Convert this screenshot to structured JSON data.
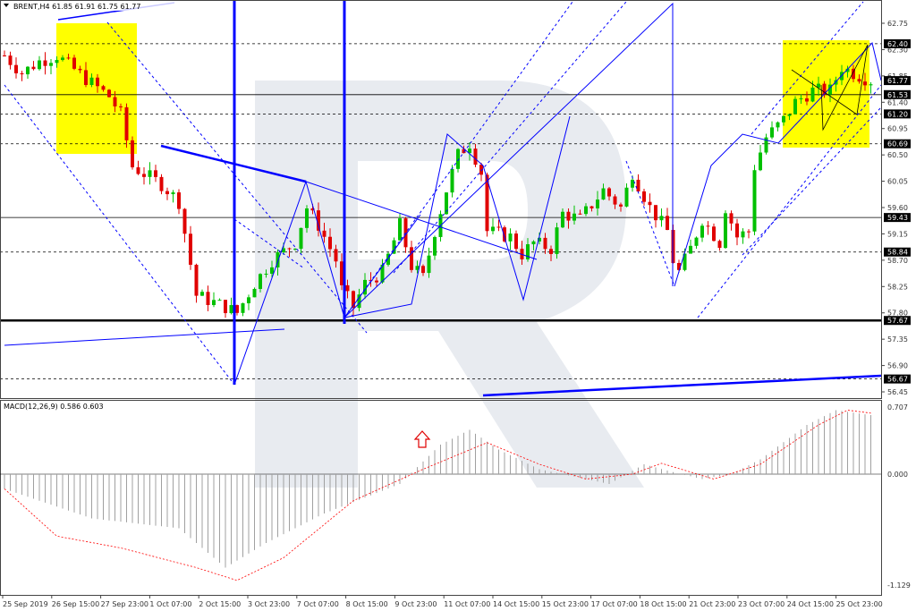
{
  "chart_data": {
    "type": "candlestick",
    "title": "BRENT,H4  61.85 61.91 61.75 61.77",
    "symbol": "BRENT",
    "timeframe": "H4",
    "ohlc_last": {
      "open": 61.85,
      "high": 61.91,
      "low": 61.75,
      "close": 61.77
    },
    "ylim": [
      56.4,
      62.9
    ],
    "y_ticks": [
      "62.75",
      "62.30",
      "61.85",
      "61.40",
      "60.95",
      "60.50",
      "60.05",
      "59.60",
      "59.15",
      "58.70",
      "58.25",
      "57.80",
      "57.35",
      "56.90",
      "56.45"
    ],
    "price_levels": [
      {
        "value": "62.40",
        "style": "dotted"
      },
      {
        "value": "61.77",
        "style": "current"
      },
      {
        "value": "61.53",
        "style": "solid"
      },
      {
        "value": "61.20",
        "style": "dotted"
      },
      {
        "value": "60.69",
        "style": "dotted"
      },
      {
        "value": "59.43",
        "style": "solid"
      },
      {
        "value": "58.84",
        "style": "dotted"
      },
      {
        "value": "57.67",
        "style": "thick"
      },
      {
        "value": "56.67",
        "style": "dotted"
      }
    ],
    "x_ticks": [
      "25 Sep 2019",
      "26 Sep 15:00",
      "27 Sep 23:00",
      "1 Oct 07:00",
      "2 Oct 15:00",
      "3 Oct 23:00",
      "7 Oct 07:00",
      "8 Oct 15:00",
      "9 Oct 23:00",
      "11 Oct 07:00",
      "14 Oct 15:00",
      "15 Oct 23:00",
      "17 Oct 07:00",
      "18 Oct 15:00",
      "21 Oct 23:00",
      "23 Oct 07:00",
      "24 Oct 15:00",
      "25 Oct 23:00"
    ],
    "candle_count": 150,
    "close_path": [
      [
        0,
        62.2
      ],
      [
        3,
        61.9
      ],
      [
        6,
        62.1
      ],
      [
        9,
        62.2
      ],
      [
        14,
        61.8
      ],
      [
        18,
        61.5
      ],
      [
        20,
        61.2
      ],
      [
        22,
        60.3
      ],
      [
        27,
        60.0
      ],
      [
        30,
        59.7
      ],
      [
        33,
        58.1
      ],
      [
        38,
        57.9
      ],
      [
        40,
        57.8
      ],
      [
        43,
        58.3
      ],
      [
        46,
        58.7
      ],
      [
        50,
        59.0
      ],
      [
        52,
        59.6
      ],
      [
        54,
        59.3
      ],
      [
        57,
        58.7
      ],
      [
        58,
        58.2
      ],
      [
        60,
        57.9
      ],
      [
        62,
        58.3
      ],
      [
        65,
        58.5
      ],
      [
        68,
        59.3
      ],
      [
        70,
        58.6
      ],
      [
        72,
        58.4
      ],
      [
        74,
        59.2
      ],
      [
        76,
        59.9
      ],
      [
        78,
        60.5
      ],
      [
        80,
        60.7
      ],
      [
        82,
        60.2
      ],
      [
        83,
        59.2
      ],
      [
        87,
        59.1
      ],
      [
        89,
        58.8
      ],
      [
        91,
        59.0
      ],
      [
        94,
        58.9
      ],
      [
        96,
        59.5
      ],
      [
        99,
        59.4
      ],
      [
        103,
        59.9
      ],
      [
        106,
        59.6
      ],
      [
        108,
        60.2
      ],
      [
        111,
        59.6
      ],
      [
        114,
        59.2
      ],
      [
        115,
        58.7
      ],
      [
        116,
        58.5
      ],
      [
        118,
        58.9
      ],
      [
        120,
        59.4
      ],
      [
        123,
        59.0
      ],
      [
        124,
        59.6
      ],
      [
        126,
        59.1
      ],
      [
        128,
        59.2
      ],
      [
        129,
        60.3
      ],
      [
        131,
        60.8
      ],
      [
        134,
        61.1
      ],
      [
        136,
        61.4
      ],
      [
        139,
        61.6
      ],
      [
        142,
        61.6
      ],
      [
        144,
        62.0
      ],
      [
        146,
        61.9
      ],
      [
        149,
        61.77
      ]
    ],
    "macd": {
      "label": "MACD(12,26,9) 0.586 0.603",
      "y_ticks": [
        "0.707",
        "0.000",
        "-1.129"
      ],
      "ylim": [
        -1.129,
        0.707
      ],
      "histogram_path": [
        [
          0,
          -0.15
        ],
        [
          15,
          -0.45
        ],
        [
          30,
          -0.55
        ],
        [
          38,
          -0.95
        ],
        [
          45,
          -0.7
        ],
        [
          55,
          -0.4
        ],
        [
          68,
          -0.1
        ],
        [
          75,
          0.3
        ],
        [
          80,
          0.45
        ],
        [
          85,
          0.25
        ],
        [
          92,
          0.05
        ],
        [
          100,
          -0.05
        ],
        [
          104,
          -0.1
        ],
        [
          110,
          0.1
        ],
        [
          115,
          0.02
        ],
        [
          120,
          -0.05
        ],
        [
          125,
          0.0
        ],
        [
          130,
          0.15
        ],
        [
          138,
          0.5
        ],
        [
          143,
          0.65
        ],
        [
          149,
          0.6
        ]
      ],
      "signal_path": [
        [
          0,
          -0.15
        ],
        [
          9,
          -0.63
        ],
        [
          20,
          -0.75
        ],
        [
          33,
          -0.95
        ],
        [
          40,
          -1.08
        ],
        [
          48,
          -0.85
        ],
        [
          60,
          -0.27
        ],
        [
          72,
          0.05
        ],
        [
          83,
          0.32
        ],
        [
          92,
          0.1
        ],
        [
          100,
          -0.05
        ],
        [
          108,
          0.0
        ],
        [
          113,
          0.11
        ],
        [
          122,
          -0.05
        ],
        [
          130,
          0.1
        ],
        [
          140,
          0.5
        ],
        [
          145,
          0.65
        ],
        [
          149,
          0.62
        ]
      ]
    },
    "colors": {
      "up": "#00c000",
      "down": "#e00000",
      "lines": "#0000ff",
      "zone": "#ffff00",
      "signal": "#ff0000",
      "hist": "#a0a0a0"
    }
  }
}
